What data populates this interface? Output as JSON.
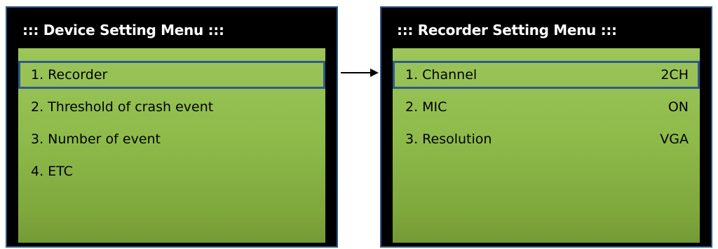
{
  "left_menu": {
    "title": "::: Device Setting Menu :::",
    "items": [
      {
        "label": "1. Recorder",
        "selected": true
      },
      {
        "label": "2. Threshold of crash event",
        "selected": false
      },
      {
        "label": "3. Number of event",
        "selected": false
      },
      {
        "label": "4. ETC",
        "selected": false
      }
    ]
  },
  "right_menu": {
    "title": "::: Recorder Setting Menu :::",
    "items": [
      {
        "label": "1. Channel",
        "value": "2CH",
        "selected": true
      },
      {
        "label": "2. MIC",
        "value": "ON",
        "selected": false
      },
      {
        "label": "3. Resolution",
        "value": "VGA",
        "selected": false
      }
    ]
  },
  "colors": {
    "frame_border": "#2d5a8c",
    "screen_green": "#8fbb4b",
    "panel_bg": "#000000",
    "title_text": "#ffffff"
  },
  "icons": {
    "transition_arrow": "arrow-right-icon"
  }
}
